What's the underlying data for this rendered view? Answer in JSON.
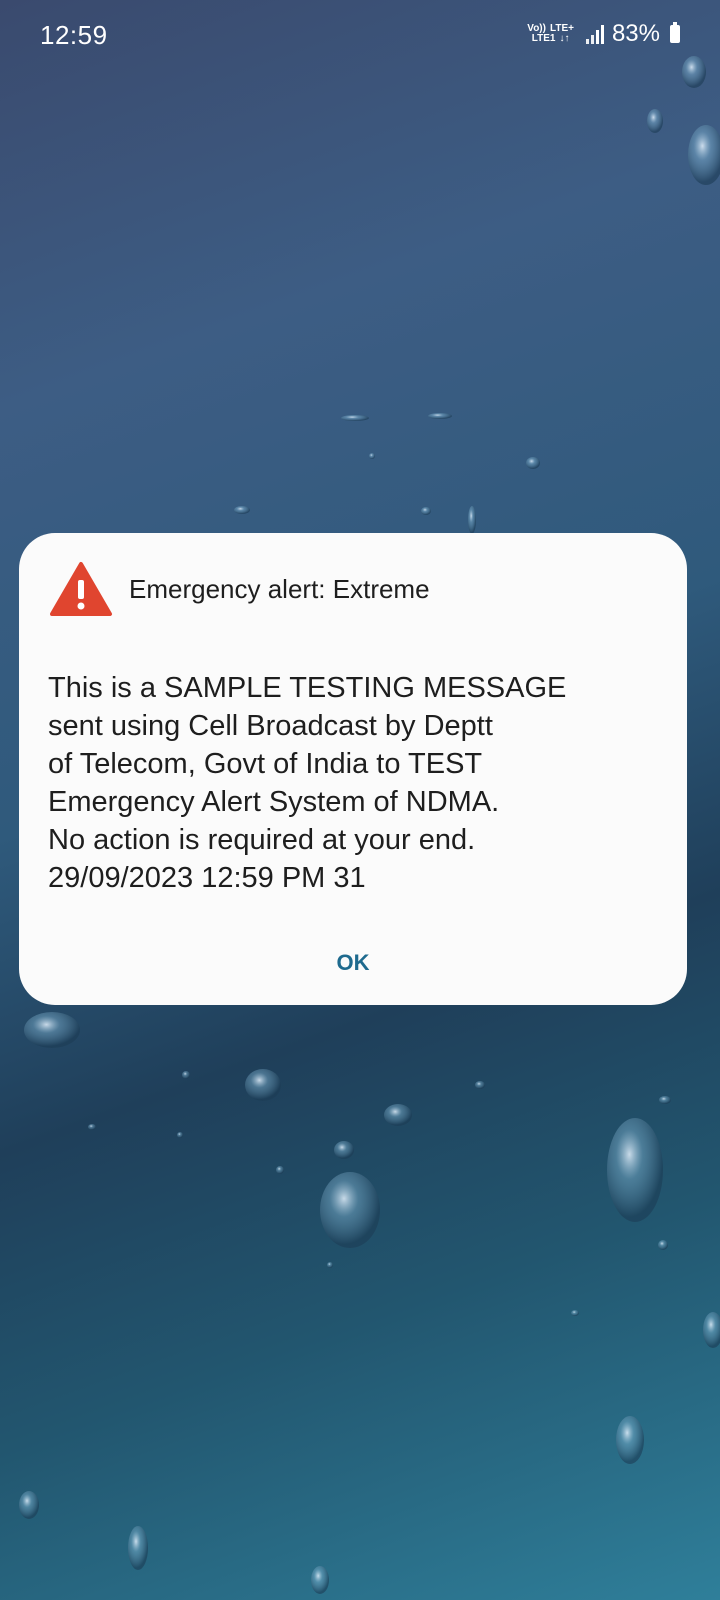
{
  "status_bar": {
    "time": "12:59",
    "volte_label": "Vo))",
    "lte_label": "LTE1",
    "lte_plus_label": "LTE+",
    "data_arrows": "↓↑",
    "battery_percent": "83%",
    "battery_level": 0.83,
    "signal_icon": "signal-bars-icon",
    "battery_icon": "battery-icon"
  },
  "alert": {
    "icon": "warning-triangle-icon",
    "icon_color": "#e0452f",
    "title": "Emergency alert: Extreme",
    "message": "This is a SAMPLE TESTING MESSAGE\nsent using Cell Broadcast by Deptt\nof Telecom, Govt of India to TEST\nEmergency Alert System of NDMA.\nNo action is required at your end.\n29/09/2023 12:59 PM 31",
    "ok_label": "OK",
    "ok_color": "#1e6a8e"
  }
}
